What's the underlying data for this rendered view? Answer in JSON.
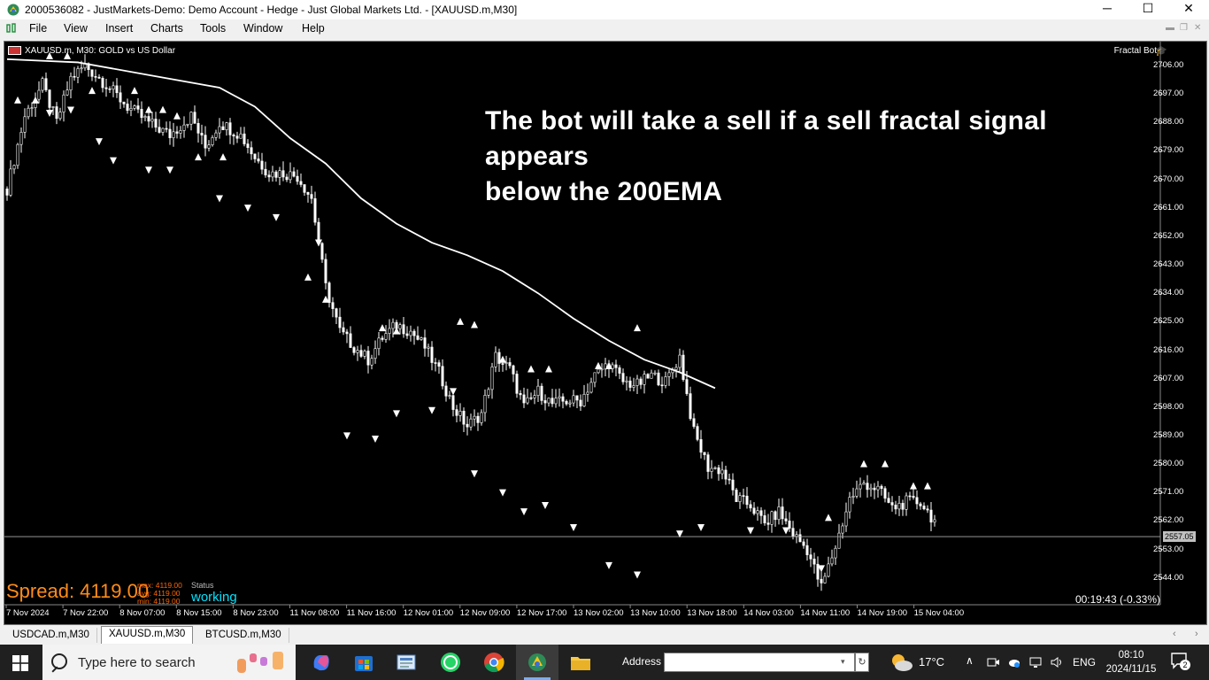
{
  "window": {
    "title": "2000536082 - JustMarkets-Demo: Demo Account - Hedge - Just Global Markets Ltd. - [XAUUSD.m,M30]",
    "minimize": "─",
    "maximize": "☐",
    "close": "✕"
  },
  "menu": {
    "items": [
      "File",
      "View",
      "Insert",
      "Charts",
      "Tools",
      "Window",
      "Help"
    ]
  },
  "chart": {
    "header": "XAUUSD.m, M30:  GOLD vs US Dollar",
    "ea_name": "Fractal Bot",
    "annotation_line1": "The bot will take a sell if a sell fractal signal appears",
    "annotation_line2": "below the 200EMA",
    "spread_label": "Spread: 4119.00",
    "stats": {
      "max": "max: 4119.00",
      "avg": "avg: 4119.00",
      "min": "min: 4119.00"
    },
    "status_label": "Status",
    "status_value": "working",
    "timer": "00:19:43 (-0.33%)",
    "current_price": "2557.05"
  },
  "chart_data": {
    "type": "candlestick",
    "symbol": "XAUUSD.m",
    "timeframe": "M30",
    "ylim": [
      2539,
      2711
    ],
    "y_ticks": [
      "2706.00",
      "2697.00",
      "2688.00",
      "2679.00",
      "2670.00",
      "2661.00",
      "2652.00",
      "2643.00",
      "2634.00",
      "2625.00",
      "2616.00",
      "2607.00",
      "2598.00",
      "2589.00",
      "2580.00",
      "2571.00",
      "2562.00",
      "2553.00",
      "2544.00"
    ],
    "x_ticks": [
      "7 Nov 2024",
      "7 Nov 22:00",
      "8 Nov 07:00",
      "8 Nov 15:00",
      "8 Nov 23:00",
      "11 Nov 08:00",
      "11 Nov 16:00",
      "12 Nov 01:00",
      "12 Nov 09:00",
      "12 Nov 17:00",
      "13 Nov 02:00",
      "13 Nov 10:00",
      "13 Nov 18:00",
      "14 Nov 03:00",
      "14 Nov 11:00",
      "14 Nov 19:00",
      "15 Nov 04:00"
    ],
    "price_path": [
      [
        0,
        2667
      ],
      [
        5,
        2690
      ],
      [
        10,
        2700
      ],
      [
        14,
        2688
      ],
      [
        18,
        2702
      ],
      [
        22,
        2706
      ],
      [
        28,
        2700
      ],
      [
        34,
        2693
      ],
      [
        40,
        2688
      ],
      [
        46,
        2684
      ],
      [
        52,
        2690
      ],
      [
        56,
        2680
      ],
      [
        60,
        2688
      ],
      [
        66,
        2684
      ],
      [
        70,
        2677
      ],
      [
        74,
        2672
      ],
      [
        78,
        2672
      ],
      [
        82,
        2671
      ],
      [
        86,
        2664
      ],
      [
        90,
        2636
      ],
      [
        94,
        2622
      ],
      [
        98,
        2617
      ],
      [
        102,
        2613
      ],
      [
        106,
        2620
      ],
      [
        110,
        2624
      ],
      [
        114,
        2622
      ],
      [
        118,
        2617
      ],
      [
        122,
        2609
      ],
      [
        126,
        2598
      ],
      [
        130,
        2592
      ],
      [
        134,
        2596
      ],
      [
        138,
        2614
      ],
      [
        142,
        2610
      ],
      [
        146,
        2598
      ],
      [
        150,
        2603
      ],
      [
        154,
        2599
      ],
      [
        158,
        2600
      ],
      [
        162,
        2600
      ],
      [
        166,
        2608
      ],
      [
        170,
        2612
      ],
      [
        174,
        2606
      ],
      [
        178,
        2605
      ],
      [
        182,
        2608
      ],
      [
        186,
        2606
      ],
      [
        190,
        2614
      ],
      [
        194,
        2590
      ],
      [
        198,
        2579
      ],
      [
        202,
        2578
      ],
      [
        206,
        2569
      ],
      [
        210,
        2567
      ],
      [
        214,
        2561
      ],
      [
        218,
        2565
      ],
      [
        222,
        2558
      ],
      [
        226,
        2553
      ],
      [
        230,
        2541
      ],
      [
        234,
        2554
      ],
      [
        238,
        2569
      ],
      [
        242,
        2574
      ],
      [
        246,
        2572
      ],
      [
        250,
        2566
      ],
      [
        254,
        2568
      ],
      [
        258,
        2568
      ],
      [
        262,
        2562
      ]
    ],
    "ema200": [
      [
        0,
        2708
      ],
      [
        20,
        2707
      ],
      [
        40,
        2703
      ],
      [
        60,
        2699
      ],
      [
        70,
        2693
      ],
      [
        80,
        2683
      ],
      [
        90,
        2675
      ],
      [
        100,
        2664
      ],
      [
        110,
        2656
      ],
      [
        120,
        2650
      ],
      [
        130,
        2646
      ],
      [
        140,
        2641
      ],
      [
        150,
        2634
      ],
      [
        160,
        2626
      ],
      [
        170,
        2619
      ],
      [
        180,
        2613
      ],
      [
        190,
        2609
      ],
      [
        200,
        2604
      ]
    ],
    "fractals": {
      "up": [
        [
          3,
          2694
        ],
        [
          8,
          2694
        ],
        [
          12,
          2708
        ],
        [
          17,
          2708
        ],
        [
          24,
          2697
        ],
        [
          36,
          2697
        ],
        [
          40,
          2691
        ],
        [
          44,
          2691
        ],
        [
          48,
          2689
        ],
        [
          54,
          2676
        ],
        [
          61,
          2676
        ],
        [
          85,
          2638
        ],
        [
          90,
          2631
        ],
        [
          106,
          2622
        ],
        [
          110,
          2621
        ],
        [
          128,
          2624
        ],
        [
          132,
          2623
        ],
        [
          140,
          2612
        ],
        [
          148,
          2609
        ],
        [
          153,
          2609
        ],
        [
          167,
          2610
        ],
        [
          170,
          2610
        ],
        [
          178,
          2622
        ],
        [
          232,
          2562
        ],
        [
          242,
          2579
        ],
        [
          248,
          2579
        ],
        [
          256,
          2572
        ],
        [
          260,
          2572
        ]
      ],
      "down": [
        [
          12,
          2692
        ],
        [
          18,
          2693
        ],
        [
          26,
          2683
        ],
        [
          30,
          2677
        ],
        [
          40,
          2674
        ],
        [
          46,
          2674
        ],
        [
          60,
          2665
        ],
        [
          68,
          2662
        ],
        [
          76,
          2659
        ],
        [
          88,
          2651
        ],
        [
          96,
          2590
        ],
        [
          104,
          2589
        ],
        [
          110,
          2597
        ],
        [
          120,
          2598
        ],
        [
          126,
          2604
        ],
        [
          132,
          2578
        ],
        [
          140,
          2572
        ],
        [
          146,
          2566
        ],
        [
          152,
          2568
        ],
        [
          160,
          2561
        ],
        [
          170,
          2549
        ],
        [
          178,
          2546
        ],
        [
          190,
          2559
        ],
        [
          196,
          2561
        ],
        [
          210,
          2560
        ],
        [
          220,
          2560
        ],
        [
          230,
          2548
        ]
      ]
    }
  },
  "tabs": [
    "USDCAD.m,M30",
    "XAUUSD.m,M30",
    "BTCUSD.m,M30"
  ],
  "tabs_active": "XAUUSD.m,M30",
  "taskbar": {
    "search_placeholder": "Type here to search",
    "address_label": "Address",
    "address_value": "",
    "temperature": "17°C",
    "language": "ENG",
    "time": "08:10",
    "date": "2024/11/15",
    "notifications": "2",
    "apps": [
      "windows-start",
      "copilot",
      "microsoft-store",
      "news",
      "whatsapp",
      "chrome",
      "metatrader",
      "file-explorer"
    ]
  },
  "colors": {
    "chart_bg": "#000000",
    "candle": "#ffffff",
    "ema": "#ffffff",
    "spread": "#ff8c1a",
    "status": "#00e5ff"
  }
}
